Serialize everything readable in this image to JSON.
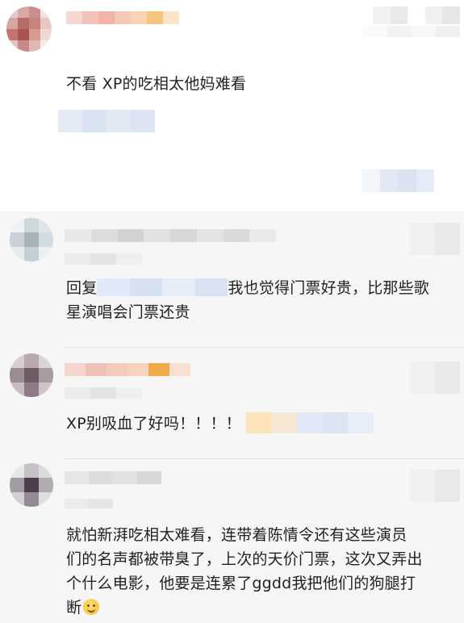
{
  "main_comment": {
    "text": "不看 XP的吃相太他妈难看"
  },
  "replies": [
    {
      "prefix": "回复",
      "text": "我也觉得门票好贵，比那些歌",
      "text_line2": "星演唱会门票还贵"
    },
    {
      "text": "XP别吸血了好吗！！！！"
    },
    {
      "text_line1": "就怕新湃吃相太难看，连带着陈情令还有这些演员",
      "text_line2": "们的名声都被带臭了，上次的天价门票，这次又弄出",
      "text_line3": "个什么电影，他要是连累了ggdd我把他们的狗腿打",
      "text_line4": "断",
      "emoji": "smile-emoji-icon"
    }
  ]
}
